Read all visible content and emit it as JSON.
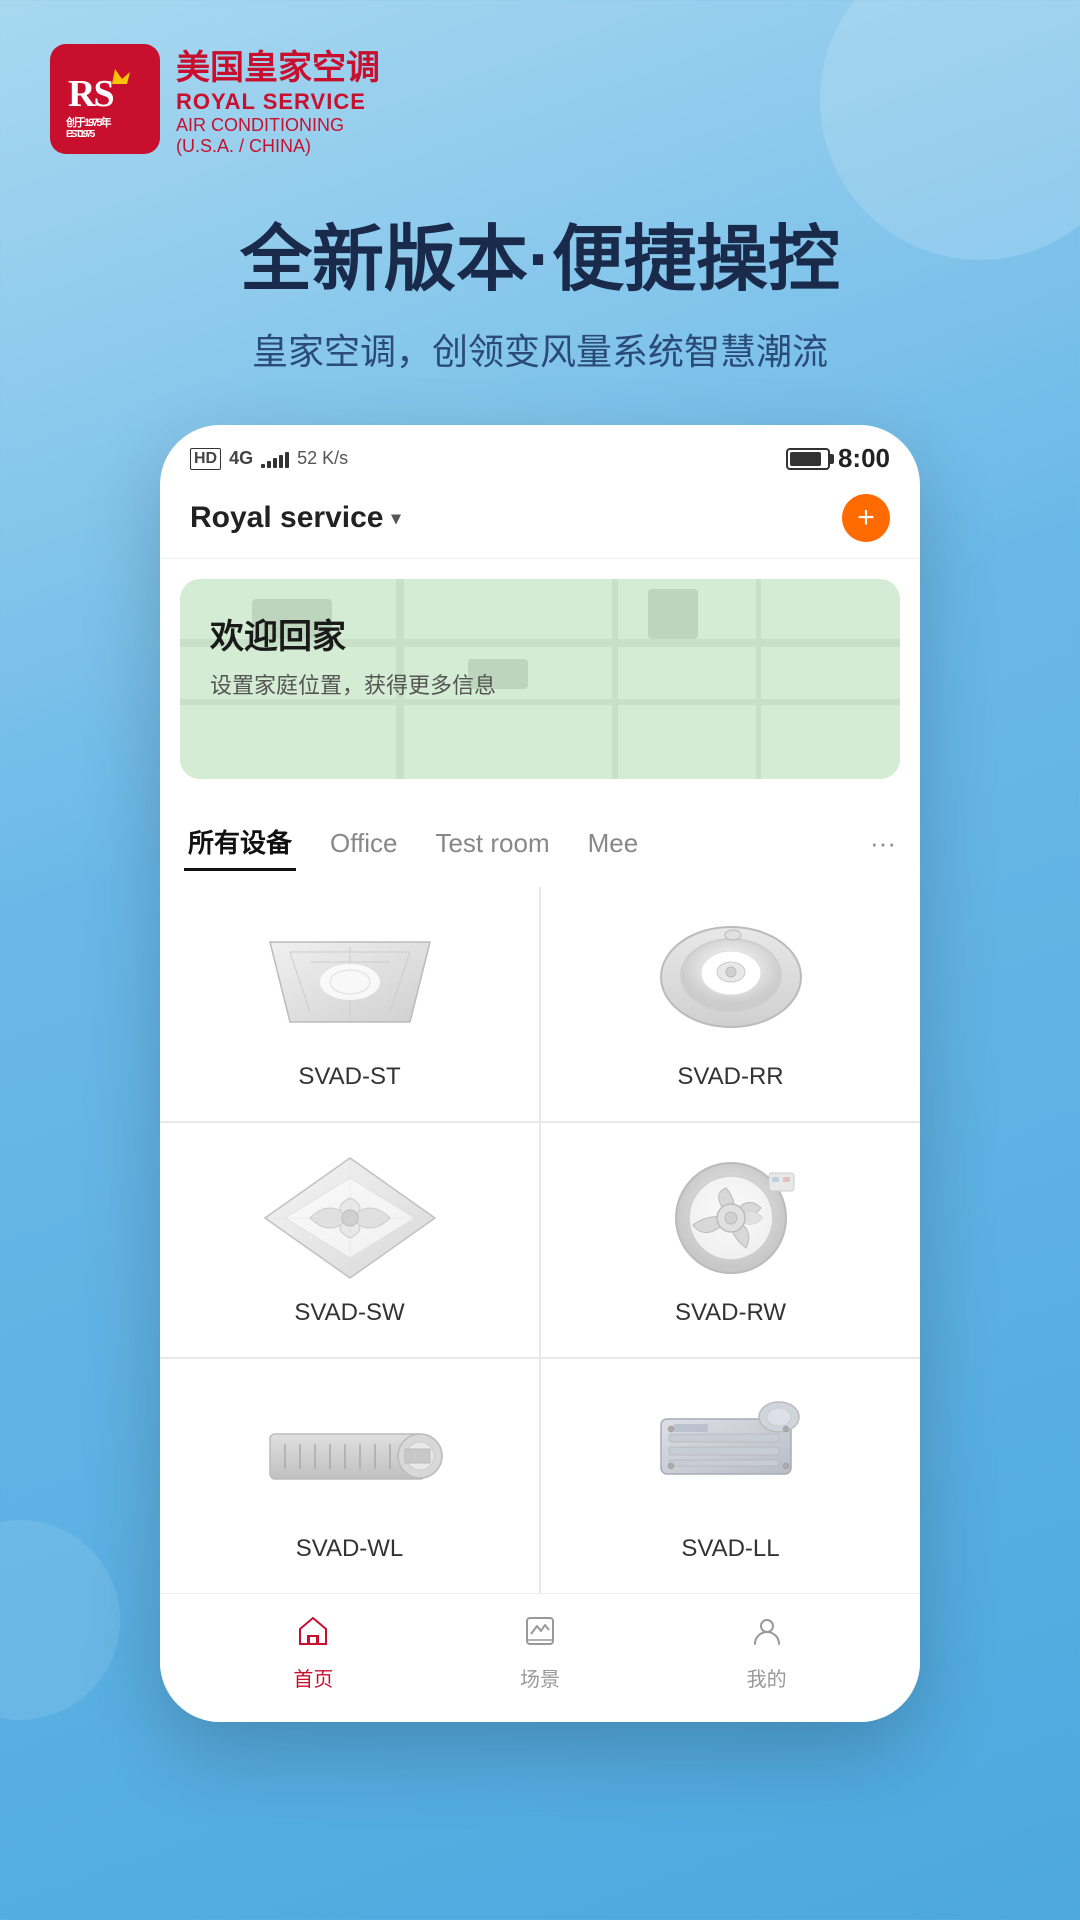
{
  "header": {
    "logo_rs": "RS",
    "brand_cn": "美国皇家空调",
    "brand_en1": "ROYAL SERVICE",
    "brand_en2": "AIR CONDITIONING",
    "brand_en3": "(U.S.A. / CHINA)",
    "brand_year": "创于1975年 EST.1975"
  },
  "hero": {
    "title": "全新版本·便捷操控",
    "subtitle": "皇家空调，创领变风量系统智慧潮流"
  },
  "phone": {
    "status": {
      "network": "4G",
      "signal": "5",
      "speed": "52 K/s",
      "battery": "95",
      "time": "8:00"
    },
    "topbar": {
      "service_name": "Royal service",
      "dropdown_symbol": "▾",
      "add_button": "+"
    },
    "map_card": {
      "welcome": "欢迎回家",
      "desc": "设置家庭位置，获得更多信息"
    },
    "tabs": [
      {
        "id": "all",
        "label": "所有设备",
        "active": true
      },
      {
        "id": "office",
        "label": "Office",
        "active": false
      },
      {
        "id": "testroom",
        "label": "Test room",
        "active": false
      },
      {
        "id": "mee",
        "label": "Mee",
        "active": false
      },
      {
        "id": "more",
        "label": "···",
        "active": false
      }
    ],
    "devices": [
      {
        "id": "svad-st",
        "name": "SVAD-ST",
        "type": "square-ceiling"
      },
      {
        "id": "svad-rr",
        "name": "SVAD-RR",
        "type": "round-ceiling"
      },
      {
        "id": "svad-sw",
        "name": "SVAD-SW",
        "type": "diamond-diffuser"
      },
      {
        "id": "svad-rw",
        "name": "SVAD-RW",
        "type": "round-fan"
      },
      {
        "id": "svad-wl",
        "name": "SVAD-WL",
        "type": "wall-unit"
      },
      {
        "id": "svad-ll",
        "name": "SVAD-LL",
        "type": "ceiling-duct"
      }
    ],
    "bottom_nav": [
      {
        "id": "home",
        "label": "首页",
        "icon": "home",
        "active": true
      },
      {
        "id": "scene",
        "label": "场景",
        "icon": "scene",
        "active": false
      },
      {
        "id": "mine",
        "label": "我的",
        "icon": "user",
        "active": false
      }
    ]
  },
  "colors": {
    "primary_red": "#c8102e",
    "accent_orange": "#ff6b00",
    "bg_blue": "#6ab8e8",
    "text_dark": "#1a1a1a"
  }
}
